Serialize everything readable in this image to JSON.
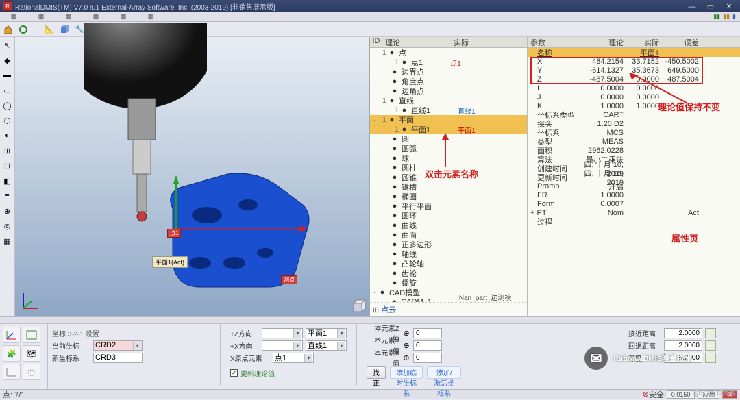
{
  "title": "RationalDMIS(TM) V7.0 ru1    External-Array Software, Inc. (2003-2019) [非销售展示版]",
  "midpanel": {
    "headers": {
      "id": "ID",
      "theory": "理论",
      "actual": "实际"
    },
    "annotation": "双击元素名称",
    "bottom_link": "点云",
    "tree": [
      {
        "d": 0,
        "exp": "-",
        "ic": "pt-y",
        "lbl": "点",
        "num": "1"
      },
      {
        "d": 1,
        "num": "1",
        "ic": "pt-y",
        "lbl": "点1",
        "act": "点1",
        "actcolor": "#c00"
      },
      {
        "d": 1,
        "ic": "dot",
        "lbl": "边界点"
      },
      {
        "d": 1,
        "ic": "dot",
        "lbl": "角度点"
      },
      {
        "d": 1,
        "ic": "dot",
        "lbl": "边角点"
      },
      {
        "d": 0,
        "exp": "-",
        "ic": "ln",
        "lbl": "直线",
        "num": "1"
      },
      {
        "d": 1,
        "num": "1",
        "ic": "ln",
        "lbl": "直线1",
        "actcolor": "#1565c0",
        "act": "直线1"
      },
      {
        "d": 0,
        "exp": "-",
        "ic": "pl",
        "lbl": "平面",
        "num": "1",
        "sel": true
      },
      {
        "d": 1,
        "num": "1",
        "ic": "pl",
        "lbl": "平面1",
        "act": "平面1",
        "sel": true,
        "actcolor": "#c00"
      },
      {
        "d": 1,
        "ic": "circ",
        "lbl": "圆"
      },
      {
        "d": 1,
        "ic": "arc",
        "lbl": "圆弧"
      },
      {
        "d": 1,
        "ic": "sph",
        "lbl": "球"
      },
      {
        "d": 1,
        "ic": "cyl",
        "lbl": "圆柱"
      },
      {
        "d": 1,
        "ic": "cone",
        "lbl": "圆锥"
      },
      {
        "d": 1,
        "ic": "slot",
        "lbl": "键槽"
      },
      {
        "d": 1,
        "ic": "ell",
        "lbl": "椭圆"
      },
      {
        "d": 1,
        "ic": "ppl",
        "lbl": "平行平面"
      },
      {
        "d": 1,
        "ic": "tor",
        "lbl": "圆环"
      },
      {
        "d": 1,
        "ic": "crv",
        "lbl": "曲线"
      },
      {
        "d": 1,
        "ic": "srf",
        "lbl": "曲面"
      },
      {
        "d": 1,
        "ic": "pol",
        "lbl": "正多边形"
      },
      {
        "d": 1,
        "ic": "axis",
        "lbl": "轴线"
      },
      {
        "d": 1,
        "ic": "gear",
        "lbl": "凸轮轴"
      },
      {
        "d": 1,
        "ic": "gear2",
        "lbl": "齿轮"
      },
      {
        "d": 1,
        "ic": "thr",
        "lbl": "螺旋"
      },
      {
        "d": 0,
        "exp": "-",
        "ic": "cad",
        "lbl": "CAD模型"
      },
      {
        "d": 1,
        "ic": "cad",
        "lbl": "CADM_1",
        "act": "Nan_part_边测模型.stp"
      }
    ]
  },
  "rightpanel": {
    "headers": {
      "param": "参数",
      "theory": "理论",
      "actual": "实际",
      "dev": "误差"
    },
    "annotation_top": "理论值保持不变",
    "annotation_mid": "属性页",
    "name_row": {
      "k": "名称",
      "v2": "平面1"
    },
    "rows": [
      {
        "k": "X",
        "v1": "484.2154",
        "v2": "33.7152",
        "v3": "-450.5002"
      },
      {
        "k": "Y",
        "v1": "-614.1327",
        "v2": "35.3673",
        "v3": "649.5000"
      },
      {
        "k": "Z",
        "v1": "-487.5004",
        "v2": "0.0000",
        "v3": "487.5004"
      },
      {
        "k": "I",
        "v1": "0.0000",
        "v2": "0.0000"
      },
      {
        "k": "J",
        "v1": "0.0000",
        "v2": "0.0000"
      },
      {
        "k": "K",
        "v1": "1.0000",
        "v2": "1.0000"
      },
      {
        "k": "坐标系类型",
        "v1": "CART"
      },
      {
        "k": "探头",
        "v1": "1.20 D2"
      },
      {
        "k": "坐标系",
        "v1": "MCS"
      },
      {
        "k": "类型",
        "v1": "MEAS"
      },
      {
        "k": "面积",
        "v1": "2962.0228"
      },
      {
        "k": "算法",
        "v1": "最小二乘法"
      },
      {
        "k": "创建时间",
        "v1": "四, 十月 10, 2019"
      },
      {
        "k": "更新时间",
        "v1": "四, 十月 10, 2019"
      },
      {
        "k": "Promp",
        "v1": "开启"
      },
      {
        "k": "FR",
        "v1": "1.0000"
      },
      {
        "k": "Form",
        "v1": "0.0007"
      }
    ],
    "pt_row": {
      "exp": "+",
      "k": "PT",
      "v1": "Nom",
      "v3": "Act"
    },
    "proc_row": {
      "k": "过程"
    }
  },
  "viewport": {
    "tag": "平面1(Act)",
    "red1": "点1",
    "red2": "测点"
  },
  "bottom": {
    "title": "坐标 3-2-1 设置",
    "cur_coord_lbl": "当前坐标",
    "cur_coord": "CRD2",
    "new_coord_lbl": "新坐标系",
    "new_coord": "CRD3",
    "z_dir_lbl": "+Z方向",
    "z_dir": "平面1",
    "x_dir_lbl": "+X方向",
    "x_dir": "直线1",
    "x_origin_lbl": "X原点元素",
    "x_origin": "点1",
    "z_val_lbl": "本元素Z值",
    "z_val": "0",
    "y_val_lbl": "本元素Y值",
    "y_val": "0",
    "x_val_lbl": "本元素X值",
    "x_val": "0",
    "chk_lbl": "更新理论值",
    "btn_find": "找正",
    "btn_add": "添加临时坐标系",
    "btn_add2": "添加/激活坐标系",
    "near_lbl": "接近距离",
    "near_val": "2.0000",
    "back_lbl": "回退距离",
    "back_val": "2.0000",
    "depth_lbl": "深度",
    "depth_val": "0.0000"
  },
  "status": {
    "left": "点: 7/1",
    "mid": "安全",
    "r1": "0.0150",
    "btn": "应用"
  },
  "watermark": "RationalDMIS测量技术",
  "watermark_id": "@51CTO博客"
}
